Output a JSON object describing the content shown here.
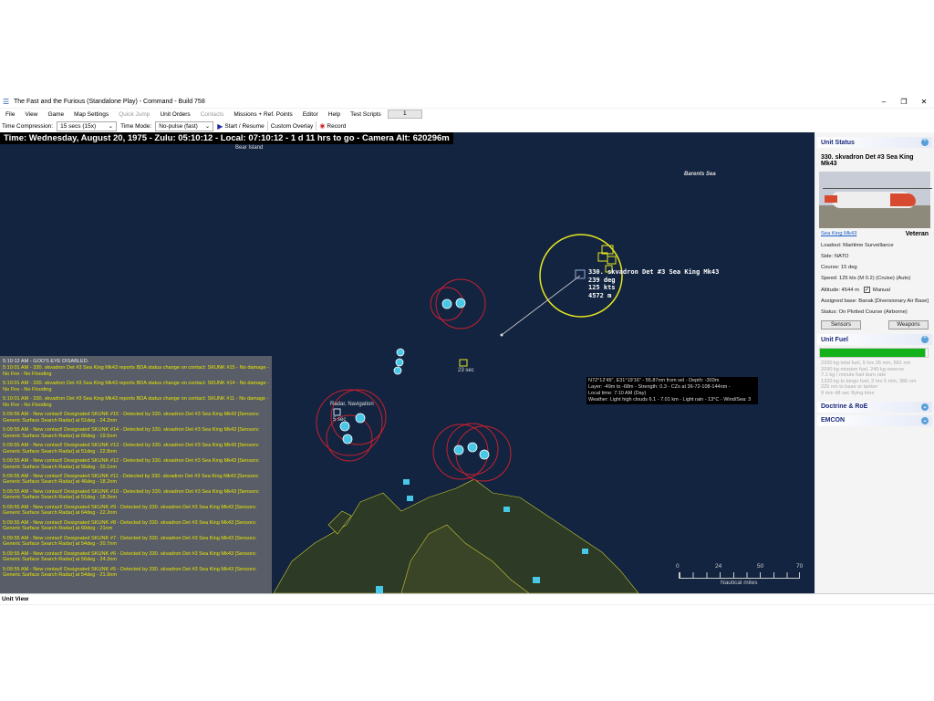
{
  "window": {
    "title": "The Fast and the Furious (Standalone Play) - Command - Build 758",
    "minimize": "–",
    "maximize": "❐",
    "close": "✕"
  },
  "menu": {
    "items": [
      "File",
      "View",
      "Game",
      "Map Settings",
      "Quick Jump",
      "Unit Orders",
      "Contacts",
      "Missions + Ref. Points",
      "Editor",
      "Help",
      "Test Scripts"
    ],
    "box_value": "1"
  },
  "toolbar": {
    "time_compression_label": "Time Compression:",
    "time_compression_value": "15 secs (15x)",
    "time_mode_label": "Time Mode:",
    "time_mode_value": "No-pulse (fast)",
    "start_label": "Start / Resume",
    "custom_overlay": "Custom Overlay",
    "record": "Record"
  },
  "map": {
    "time_bar": "Time: Wednesday, August 20, 1975 - Zulu: 05:10:12 - Local: 07:10:12 - 1 d 11 hrs to go -  Camera Alt: 620296m",
    "bear_island": "Bear Island",
    "barents_sea": "Barents Sea",
    "unit_label": [
      "330. skvadron Det #3 Sea King Mk43",
      "239 deg",
      "125 kts",
      "4572 m"
    ],
    "contact_timer": "23 sec",
    "radar_label": "Radar, Navigation",
    "radar_timer": "5 sec",
    "info": [
      "N72°12'49\", E31°19'16\" - 55.87nm from sel - Depth: -303m",
      "Layer: -49m to -68m - Strength: 0.3 - CZs at 36-72-108-144nm -",
      "Local time: 7:10 AM (Day)",
      "Weather: Light high clouds 6.1 - 7.01 km - Light rain - 13°C - Wind/Sea: 3"
    ],
    "scale": {
      "ticks": [
        "0",
        "24",
        "50",
        "70"
      ],
      "unit": "Nautical miles"
    }
  },
  "log": [
    {
      "t": "5:10:12 AM - GOD'S EYE DISABLED.",
      "white": true
    },
    {
      "t": "5:10:01 AM - 330. skvadron Det #3 Sea King Mk43 reports BDA status change on contact: SKUNK #15 - No damage - No Fire - No Flooding"
    },
    {
      "t": "5:10:01 AM - 330. skvadron Det #3 Sea King Mk43 reports BDA status change on contact: SKUNK #14 - No damage - No Fire - No Flooding"
    },
    {
      "t": "5:10:01 AM - 330. skvadron Det #3 Sea King Mk43 reports BDA status change on contact: SKUNK #11 - No damage - No Fire - No Flooding"
    },
    {
      "t": "5:09:56 AM - New contact! Designated SKUNK #15 - Detected by 330. skvadron Det #3 Sea King Mk43 [Sensors: Generic Surface Search Radar] at 51deg - 24.2nm"
    },
    {
      "t": "5:09:55 AM - New contact! Designated SKUNK #14 - Detected by 330. skvadron Det #3 Sea King Mk43 [Sensors: Generic Surface Search Radar] at 66deg - 19.5nm"
    },
    {
      "t": "5:09:55 AM - New contact! Designated SKUNK #13 - Detected by 330. skvadron Det #3 Sea King Mk43 [Sensors: Generic Surface Search Radar] at 51deg - 22.8nm"
    },
    {
      "t": "5:09:55 AM - New contact! Designated SKUNK #12 - Detected by 330. skvadron Det #3 Sea King Mk43 [Sensors: Generic Surface Search Radar] at 56deg - 20.1nm"
    },
    {
      "t": "5:09:55 AM - New contact! Designated SKUNK #11 - Detected by 330. skvadron Det #3 Sea King Mk43 [Sensors: Generic Surface Search Radar] at 46deg - 18.2nm"
    },
    {
      "t": "5:09:55 AM - New contact! Designated SKUNK #10 - Detected by 330. skvadron Det #3 Sea King Mk43 [Sensors: Generic Surface Search Radar] at 51deg - 18.3nm"
    },
    {
      "t": "5:09:55 AM - New contact! Designated SKUNK #9 - Detected by 330. skvadron Det #3 Sea King Mk43 [Sensors: Generic Surface Search Radar] at 64deg - 22.2nm"
    },
    {
      "t": "5:09:55 AM - New contact! Designated SKUNK #8 - Detected by 330. skvadron Det #3 Sea King Mk43 [Sensors: Generic Surface Search Radar] at 60deg - 21nm"
    },
    {
      "t": "5:09:55 AM - New contact! Designated SKUNK #7 - Detected by 330. skvadron Det #3 Sea King Mk43 [Sensors: Generic Surface Search Radar] at 54deg - 20.7nm"
    },
    {
      "t": "5:09:55 AM - New contact! Designated SKUNK #6 - Detected by 330. skvadron Det #3 Sea King Mk43 [Sensors: Generic Surface Search Radar] at 56deg - 24.2nm"
    },
    {
      "t": "5:09:55 AM - New contact! Designated SKUNK #5 - Detected by 330. skvadron Det #3 Sea King Mk43 [Sensors: Generic Surface Search Radar] at 54deg - 21.9nm"
    }
  ],
  "unit_status": {
    "header": "Unit Status",
    "name": "330. skvadron Det #3 Sea King Mk43",
    "class_link": "Sea King Mk43",
    "proficiency": "Veteran",
    "loadout": "Loadout: Maritime Surveillance",
    "side": "Side: NATO",
    "course": "Course: 15 deg",
    "speed": "Speed: 125 kts (M 0.2) (Cruise)   (Auto)",
    "altitude": "Altitude: 4544 m",
    "manual": "Manual",
    "base": "Assigned base: Banak [Diversionary Air Base]",
    "status": "Status: On Plotted Course (Airborne)",
    "sensors_btn": "Sensors",
    "weapons_btn": "Weapons"
  },
  "fuel": {
    "header": "Unit Fuel",
    "level": 0.98,
    "lines": [
      "2330 kg total fuel, 5 hrs 26 min, 681 nm",
      "2090 kg mission fuel, 240 kg reserve",
      "7.1 kg / minute fuel burn rate",
      "1320 kg to bingo fuel, 3 hrs 5 min, 386 nm",
      "225 nm to base or tanker",
      "9 min 48 sec flying time"
    ]
  },
  "doctrine": {
    "header": "Doctrine & RoE"
  },
  "emcon": {
    "header": "EMCON"
  },
  "status_bar": {
    "label": "Unit View"
  },
  "colors": {
    "map": "#132440",
    "accent": "#1b2a7a",
    "fuel": "#13b21a",
    "log_text": "#e6e600"
  }
}
